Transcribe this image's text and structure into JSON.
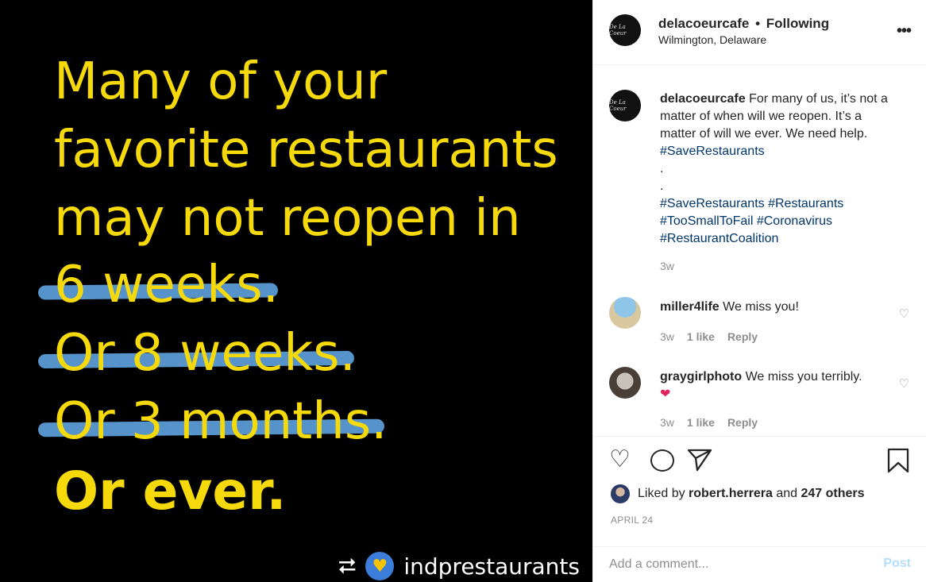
{
  "image": {
    "lines": [
      "Many of your",
      "favorite restaurants",
      "may not reopen in"
    ],
    "struck_lines": [
      "6 weeks.",
      "Or 8 weeks.",
      "Or 3 months."
    ],
    "final_line": "Or ever.",
    "repost_icon": "repost-icon",
    "repost_handle": "indprestaurants",
    "colors": {
      "background": "#000000",
      "text": "#f5d90a",
      "strike": "#5b9bd5"
    }
  },
  "header": {
    "username": "delacoeurcafe",
    "separator": "•",
    "follow_status": "Following",
    "location": "Wilmington, Delaware",
    "more_icon": "•••",
    "avatar_text": "De La Coeur"
  },
  "caption": {
    "username": "delacoeurcafe",
    "text": "For many of us, it’s not a matter of when will we reopen. It’s a matter of will we ever. We need help.",
    "tag1": "#SaveRestaurants",
    "dot1": ".",
    "dot2": ".",
    "tags": [
      "#SaveRestaurants",
      "#Restaurants",
      "#TooSmallToFail",
      "#Coronavirus",
      "#RestaurantCoalition"
    ],
    "time": "3w"
  },
  "comments": [
    {
      "username": "miller4life",
      "text": "We miss you!",
      "time": "3w",
      "likes": "1 like",
      "reply": "Reply"
    },
    {
      "username": "graygirlphoto",
      "text": "We miss you terribly.",
      "emoji": "❤",
      "time": "3w",
      "likes": "1 like",
      "reply": "Reply"
    }
  ],
  "actions": {
    "liked_prefix": "Liked by",
    "liked_user": "robert.herrera",
    "liked_and": "and",
    "liked_others": "247 others",
    "date": "APRIL 24"
  },
  "add_comment": {
    "placeholder": "Add a comment...",
    "post_label": "Post"
  }
}
